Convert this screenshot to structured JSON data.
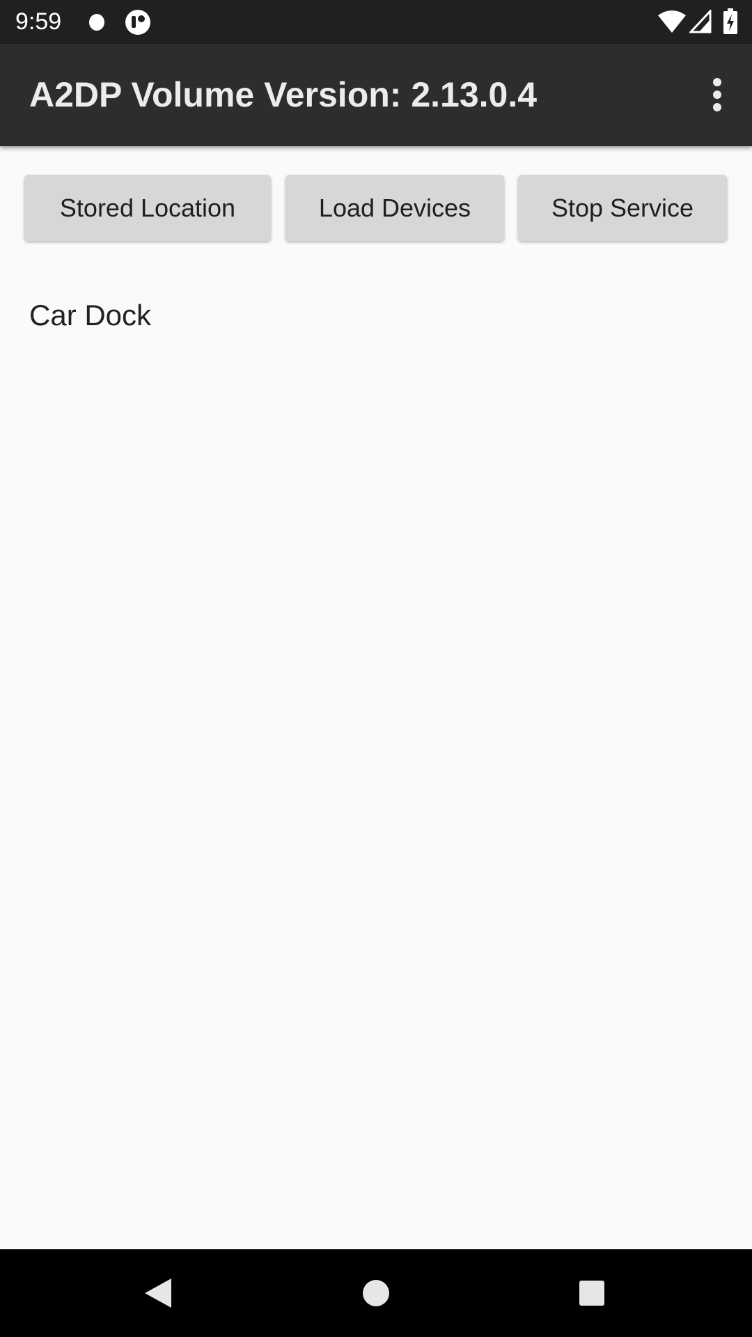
{
  "status_bar": {
    "time": "9:59",
    "icons": [
      "dot-notification-icon",
      "app-notification-icon",
      "wifi-icon",
      "signal-icon",
      "battery-charging-icon"
    ]
  },
  "app_bar": {
    "title": "A2DP Volume Version: 2.13.0.4",
    "menu_icon": "overflow-menu-icon"
  },
  "buttons": {
    "stored_location": "Stored Location",
    "load_devices": "Load Devices",
    "stop_service": "Stop Service"
  },
  "devices": [
    {
      "name": "Car Dock"
    }
  ],
  "nav_bar": {
    "icons": [
      "back-icon",
      "home-icon",
      "recents-icon"
    ]
  },
  "colors": {
    "status_bar": "#202020",
    "app_bar": "#2d2d2d",
    "background": "#fafafa",
    "button": "#d6d7d7",
    "nav_bar": "#000000"
  }
}
